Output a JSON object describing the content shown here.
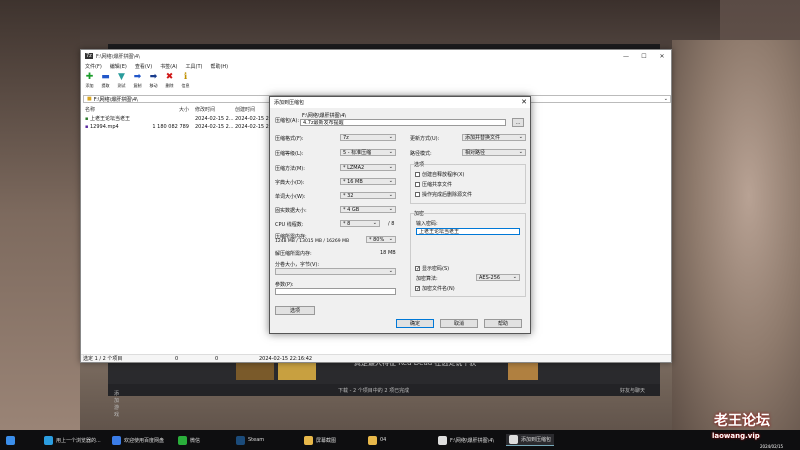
{
  "main_window": {
    "title": "F:\\网络\\爆肝拼图\\4\\",
    "menu": [
      "文件(F)",
      "编辑(E)",
      "查看(V)",
      "书签(A)",
      "工具(T)",
      "帮助(H)"
    ],
    "tools": [
      {
        "label": "添加",
        "icon": "add-icon",
        "glyph": "✚",
        "color": "#1a9c2a"
      },
      {
        "label": "提取",
        "icon": "extract-icon",
        "glyph": "▬",
        "color": "#2257c9"
      },
      {
        "label": "测试",
        "icon": "test-icon",
        "glyph": "▼",
        "color": "#2a9c9c"
      },
      {
        "label": "复制",
        "icon": "copy-icon",
        "glyph": "➡",
        "color": "#2257c9"
      },
      {
        "label": "移动",
        "icon": "move-icon",
        "glyph": "➡",
        "color": "#173b8c"
      },
      {
        "label": "删除",
        "icon": "delete-icon",
        "glyph": "✖",
        "color": "#d01818"
      },
      {
        "label": "信息",
        "icon": "info-icon",
        "glyph": "ℹ",
        "color": "#c09000"
      }
    ],
    "address": "F:\\网络\\爆肝拼图\\4\\",
    "columns": [
      "名称",
      "大小",
      "修改时间",
      "创建时间"
    ],
    "rows": [
      {
        "name": "上老王论坛当老王",
        "size": "",
        "modified": "2024-02-15 2...",
        "created": "2024-02-15 2..."
      },
      {
        "name": "12994.mp4",
        "size": "1 180 082 789",
        "modified": "2024-02-15 2...",
        "created": "2024-02-15 2..."
      }
    ],
    "status": {
      "selected": "选定 1 / 2 个项目",
      "a": "0",
      "b": "0",
      "date": "2024-02-15 22:16:42"
    }
  },
  "dialog": {
    "title": "添加到压缩包",
    "archive_label": "压缩包(A):",
    "archive_dir": "F:\\网络\\爆肝拼图\\4\\",
    "archive_name": "4.7z最新发布提醒",
    "browse": "...",
    "format_label": "压缩格式(F):",
    "format": "7z",
    "level_label": "压缩等级(L):",
    "level": "5 - 标准压缩",
    "method_label": "压缩方法(M):",
    "method": "* LZMA2",
    "dict_label": "字典大小(D):",
    "dict": "* 16 MB",
    "word_label": "单词大小(W):",
    "word": "* 32",
    "solid_label": "固实数据大小:",
    "solid": "* 4 GB",
    "threads_label": "CPU 线程数:",
    "threads": "* 8",
    "threads_max": "/ 8",
    "mem_label": "压缩所需内存:",
    "mem_value": "1248 MB / 13015 MB / 16269 MB",
    "mem_pct": "* 80%",
    "decomp_label": "解压缩所需内存:",
    "decomp_value": "18 MB",
    "split_label": "分卷大小，字节(V):",
    "split": "",
    "params_label": "参数(P):",
    "params": "",
    "options_button": "选项",
    "update_label": "更新方式(U):",
    "update": "添加并替换文件",
    "path_label": "路径模式:",
    "path": "相对路径",
    "opts_group": "选项",
    "opt1": "创建自释放程序(X)",
    "opt2": "压缩共享文件",
    "opt3": "操作完成后删除源文件",
    "enc_group": "加密",
    "pwd_label": "输入密码:",
    "pwd": "上老王论坛当老王",
    "show_pwd": "显示密码(S)",
    "enc_method_label": "加密算法:",
    "enc_method": "AES-256",
    "enc_names": "加密文件名(N)",
    "ok": "确定",
    "cancel": "取消",
    "help": "帮助"
  },
  "background": {
    "text_big": "真是最大特征 Red Dead 在远处说千获",
    "add_btn": "添加游戏",
    "download": "下载 - 2 个项目中的 2 项已完成",
    "friends": "好友与聊天"
  },
  "taskbar": [
    {
      "label": "",
      "icon": "start-icon",
      "color": "#3b8eea"
    },
    {
      "label": "用上一个浏览器的...",
      "icon": "edge-icon",
      "color": "#2b9de0"
    },
    {
      "label": "欢迎使用百度网盘",
      "icon": "baidu-netdisk-icon",
      "color": "#3b7de8"
    },
    {
      "label": "微信",
      "icon": "wechat-icon",
      "color": "#2aae3b"
    },
    {
      "label": "Steam",
      "icon": "steam-icon",
      "color": "#1b4b7a"
    },
    {
      "label": "屏幕截图",
      "icon": "folder-icon",
      "color": "#e8b84a"
    },
    {
      "label": "04",
      "icon": "folder-icon",
      "color": "#e8b84a"
    },
    {
      "label": "F:\\网络\\爆肝拼图\\4\\",
      "icon": "7zip-icon",
      "color": "#ddd"
    },
    {
      "label": "添加到压缩包",
      "icon": "7zip-icon",
      "color": "#ddd"
    }
  ],
  "watermark": {
    "main": "老王论坛",
    "sub": "laowang.vip",
    "date": "2024/02/15"
  }
}
